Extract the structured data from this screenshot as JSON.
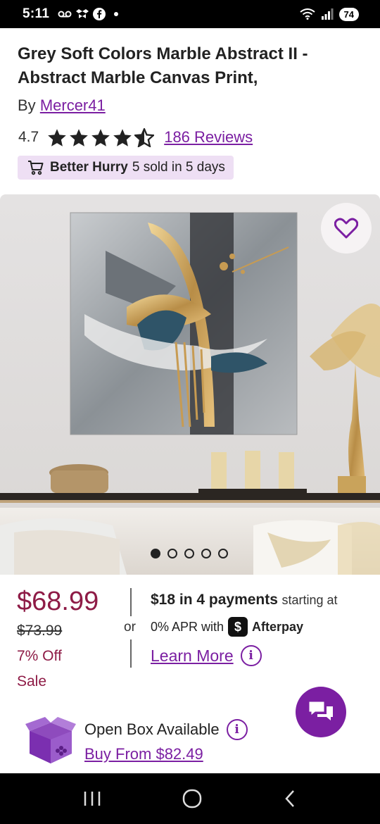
{
  "status_bar": {
    "time": "5:11",
    "battery": "74"
  },
  "product": {
    "title": "Grey Soft Colors Marble Abstract II - Abstract Marble Canvas Print,",
    "by_prefix": "By",
    "brand": "Mercer41",
    "rating": "4.7",
    "stars": 4.5,
    "reviews_label": "186 Reviews",
    "hurry_title": "Better Hurry",
    "hurry_detail": "5 sold in 5 days"
  },
  "gallery": {
    "image_count": 5,
    "active_index": 0
  },
  "pricing": {
    "price": "$68.99",
    "original_price": "$73.99",
    "discount": "7% Off",
    "sale_label": "Sale",
    "or": "or",
    "installments_bold": "$18 in 4 payments",
    "installments_rest": "starting at",
    "apr_text": "0% APR with",
    "provider": "Afterpay",
    "learn_more": "Learn More"
  },
  "open_box": {
    "label": "Open Box Available",
    "link": "Buy From $82.49"
  },
  "colors": {
    "accent": "#7b1fa2",
    "price": "#8e1b46",
    "badge_bg": "#eedff4"
  }
}
